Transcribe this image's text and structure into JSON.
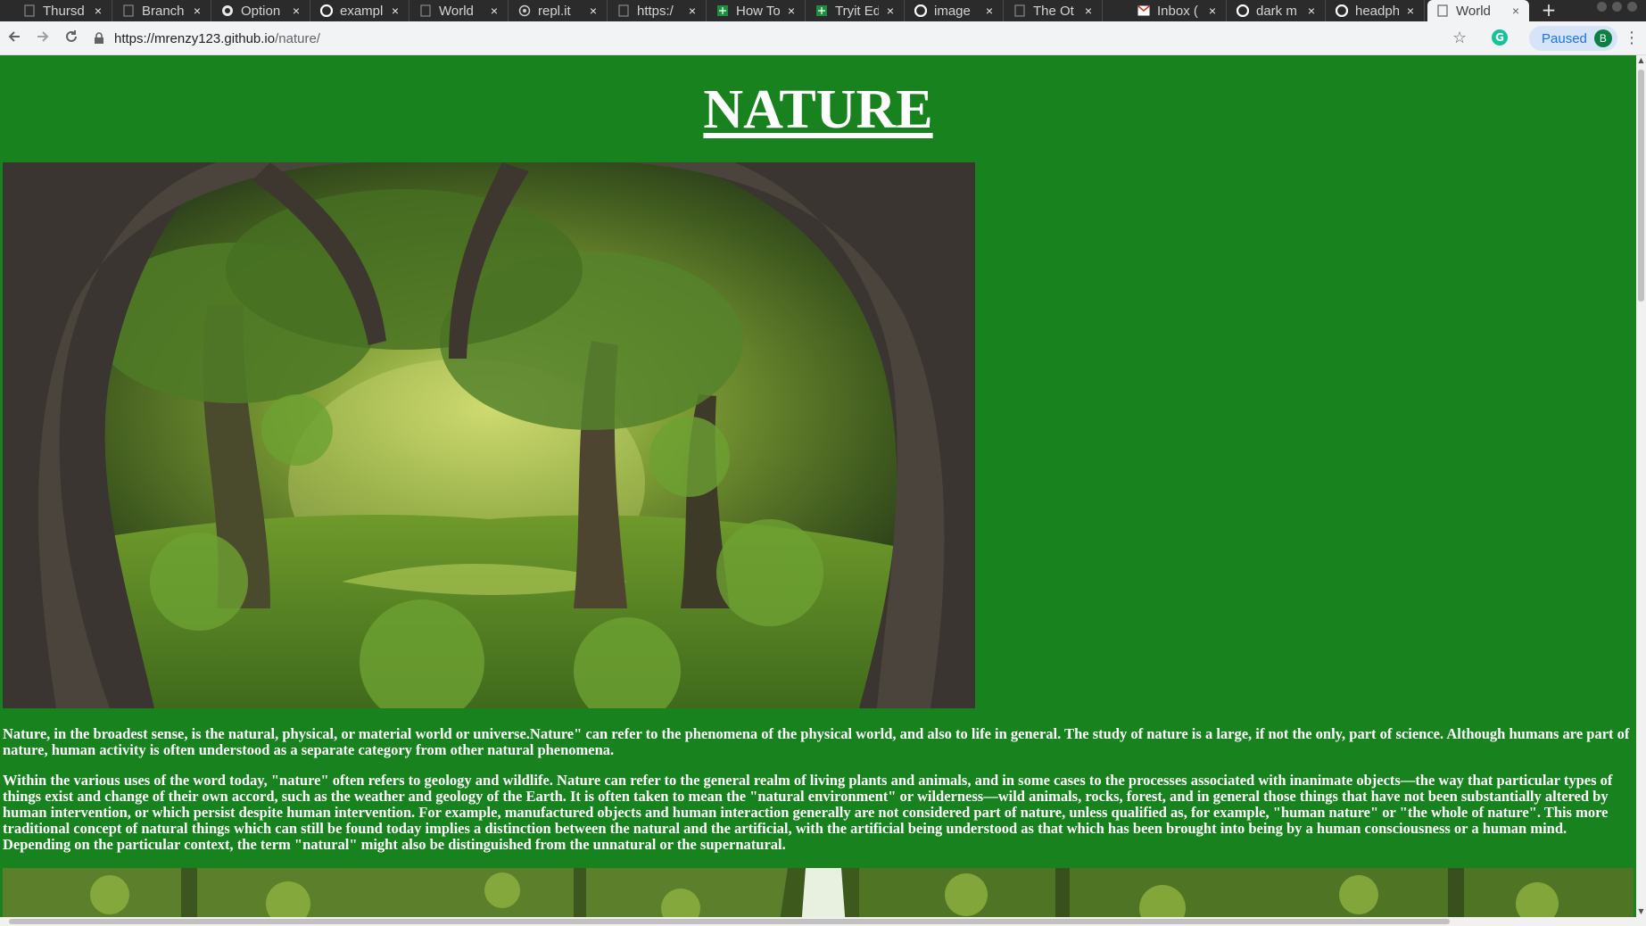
{
  "browser": {
    "tabs": [
      {
        "title": "Thursd",
        "icon": "doc-icon"
      },
      {
        "title": "Branch",
        "icon": "doc-icon"
      },
      {
        "title": "Option",
        "icon": "github-icon"
      },
      {
        "title": "exampl",
        "icon": "google-icon"
      },
      {
        "title": "World",
        "icon": "doc-icon"
      },
      {
        "title": "repl.it",
        "icon": "replit-icon"
      },
      {
        "title": "https:/",
        "icon": "doc-icon"
      },
      {
        "title": "How To",
        "icon": "sheets-icon"
      },
      {
        "title": "Tryit Ed",
        "icon": "sheets-icon"
      },
      {
        "title": "image",
        "icon": "google-icon"
      },
      {
        "title": "The Ot",
        "icon": "doc-icon"
      },
      {
        "title": "Inbox (",
        "icon": "gmail-icon"
      },
      {
        "title": "dark m",
        "icon": "google-icon"
      },
      {
        "title": "headph",
        "icon": "google-icon"
      },
      {
        "title": "World",
        "icon": "doc-icon",
        "active": true
      }
    ],
    "url_host": "https://mrenzy123.github.io",
    "url_path": "/nature/",
    "profile_status": "Paused",
    "profile_initial": "B",
    "extension_label": "G"
  },
  "page": {
    "title": "NATURE",
    "paragraphs": [
      "Nature, in the broadest sense, is the natural, physical, or material world or universe.Nature\" can refer to the phenomena of the physical world, and also to life in general. The study of nature is a large, if not the only, part of science. Although humans are part of nature, human activity is often understood as a separate category from other natural phenomena.",
      "Within the various uses of the word today, \"nature\" often refers to geology and wildlife. Nature can refer to the general realm of living plants and animals, and in some cases to the processes associated with inanimate objects—the way that particular types of things exist and change of their own accord, such as the weather and geology of the Earth. It is often taken to mean the \"natural environment\" or wilderness—wild animals, rocks, forest, and in general those things that have not been substantially altered by human intervention, or which persist despite human intervention. For example, manufactured objects and human interaction generally are not considered part of nature, unless qualified as, for example, \"human nature\" or \"the whole of nature\". This more traditional concept of natural things which can still be found today implies a distinction between the natural and the artificial, with the artificial being understood as that which has been brought into being by a human consciousness or a human mind. Depending on the particular context, the term \"natural\" might also be distinguished from the unnatural or the supernatural."
    ],
    "colors": {
      "background": "#18821f",
      "text": "#ffffff"
    }
  }
}
